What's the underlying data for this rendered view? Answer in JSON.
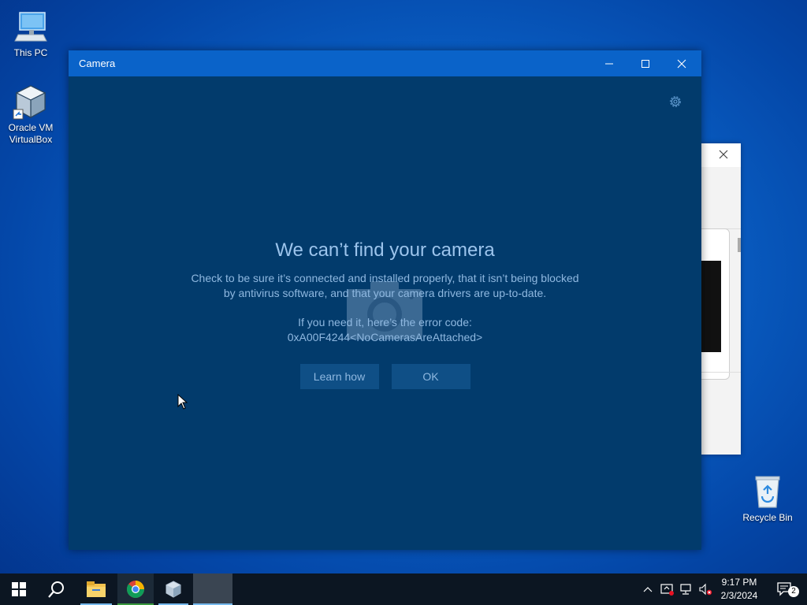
{
  "desktop": {
    "icons": [
      {
        "label": "This PC"
      },
      {
        "label": "Oracle VM VirtualBox"
      },
      {
        "label": "Recycle Bin"
      }
    ]
  },
  "camera_window": {
    "title": "Camera",
    "heading": "We can’t find your camera",
    "message_line1": "Check to be sure it’s connected and installed properly, that it isn’t being blocked",
    "message_line2": "by antivirus software, and that your camera drivers are up-to-date.",
    "error_intro": "If you need it, here’s the error code:",
    "error_code": "0xA00F4244<NoCamerasAreAttached>",
    "learn_how_label": "Learn how",
    "ok_label": "OK"
  },
  "taskbar": {
    "apps": [
      "start-icon",
      "search-icon",
      "file-explorer-icon",
      "chrome-icon",
      "virtualbox-icon",
      "camera-app"
    ],
    "time": "9:17 PM",
    "date": "2/3/2024",
    "notification_count": "2"
  }
}
